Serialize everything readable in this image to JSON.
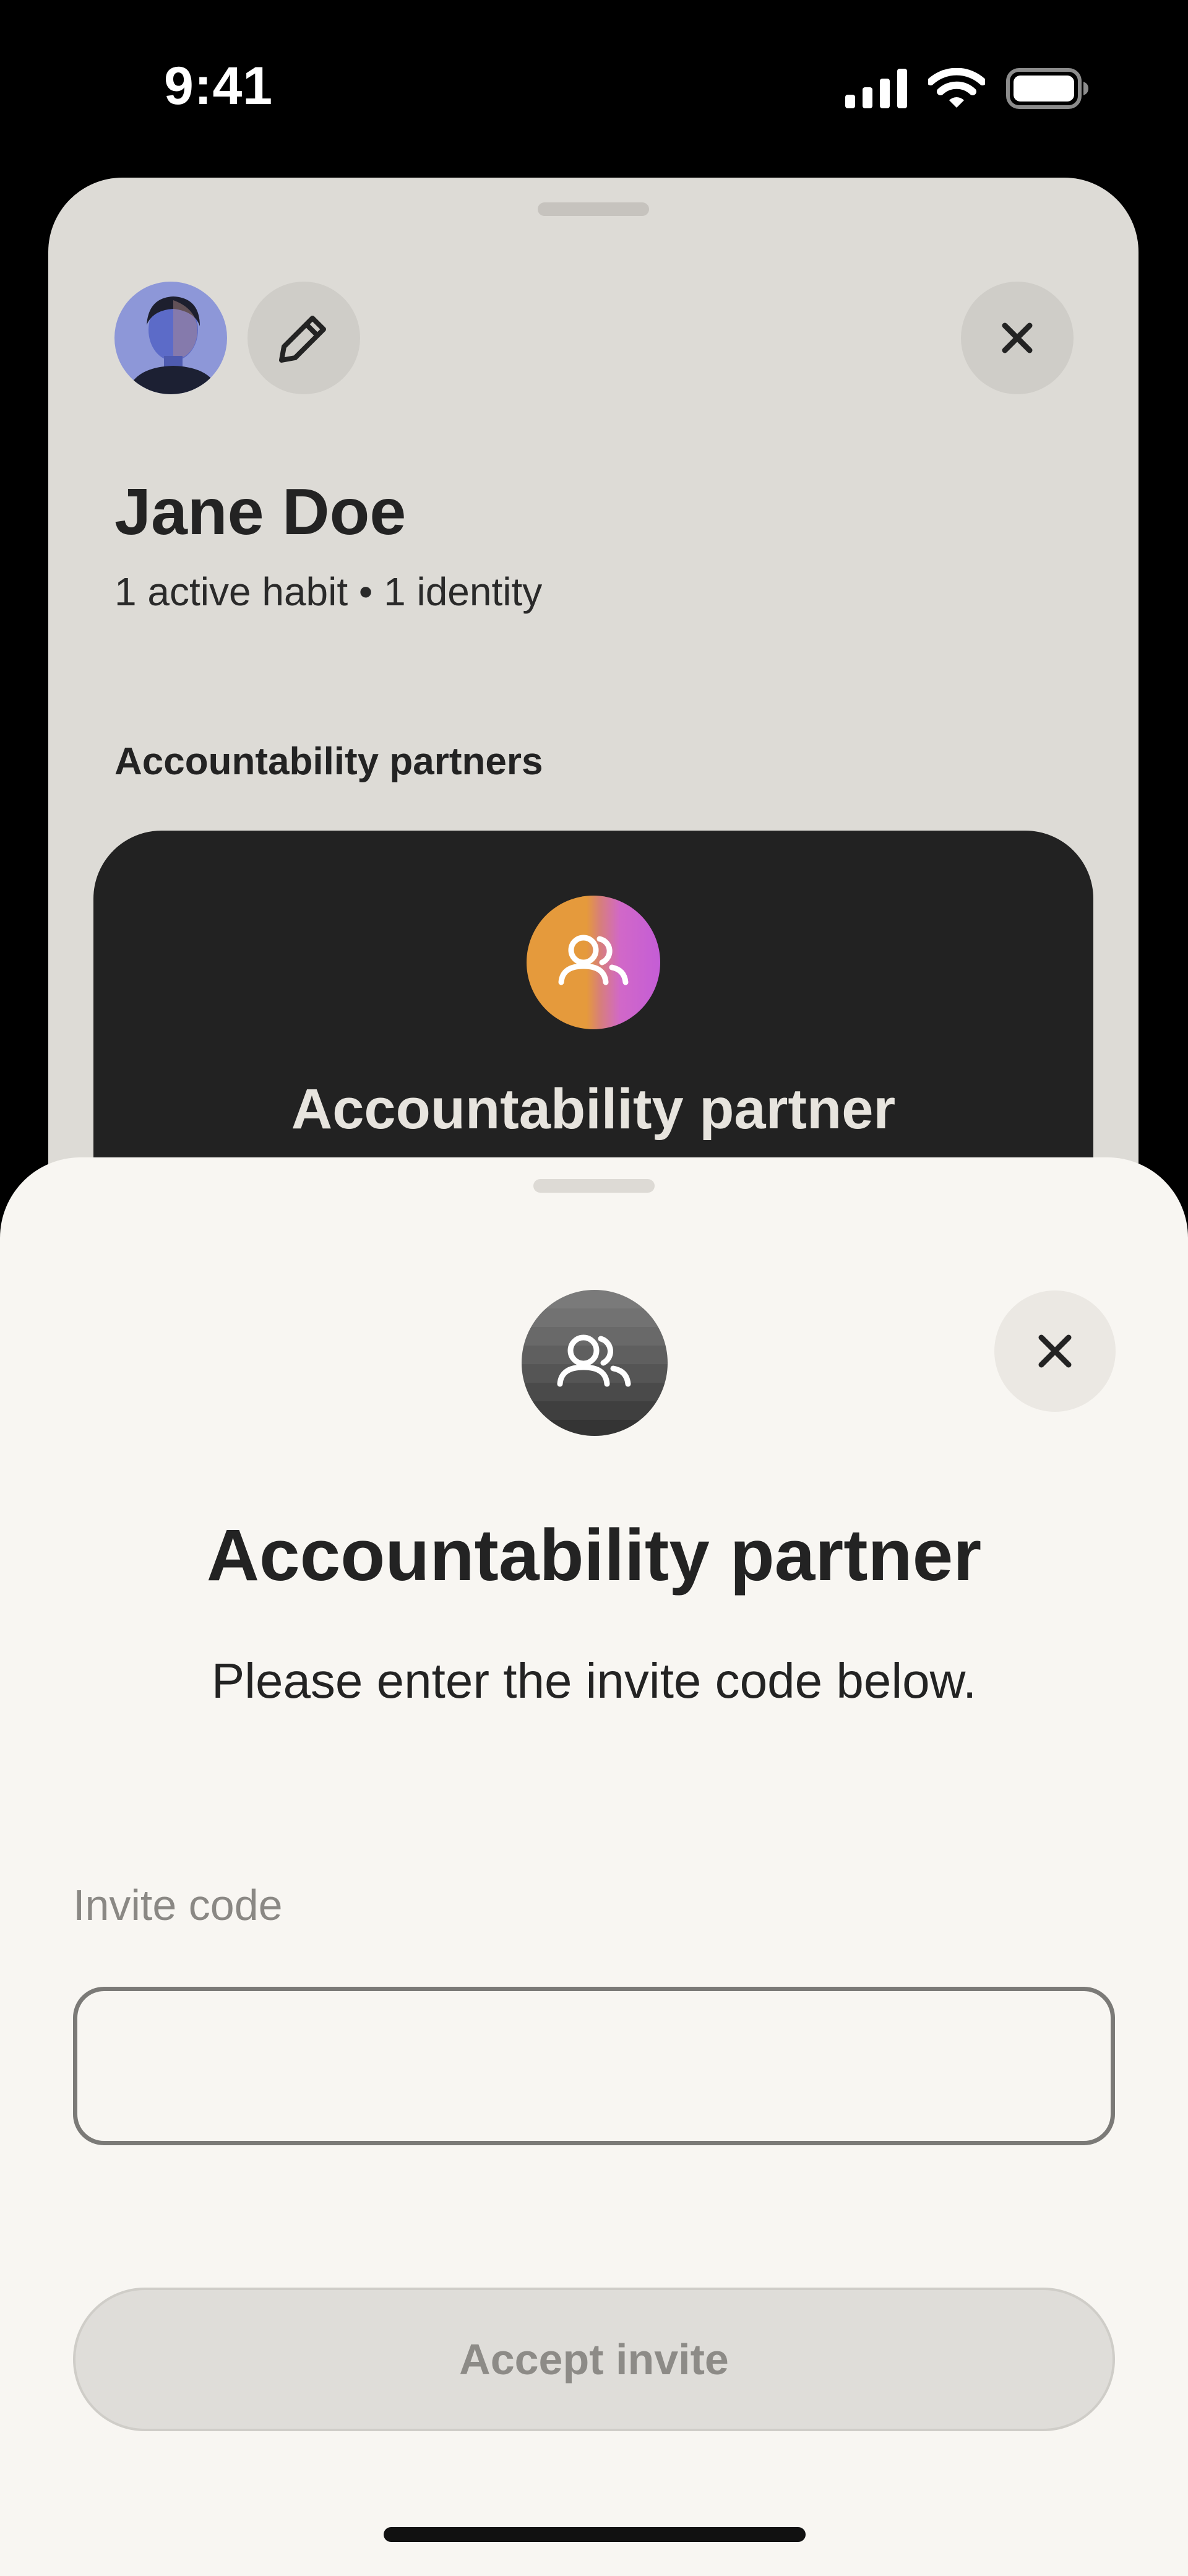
{
  "status_bar": {
    "time": "9:41",
    "icons": [
      "cellular-signal-icon",
      "wifi-icon",
      "battery-icon"
    ]
  },
  "profile": {
    "name": "Jane Doe",
    "stats": "1 active habit • 1 identity",
    "section_title": "Accountability partners",
    "partner_card_title": "Accountability partner",
    "icons": [
      "avatar",
      "pencil-icon",
      "close-icon",
      "people-icon"
    ]
  },
  "modal": {
    "title": "Accountability partner",
    "subtitle": "Please enter the invite code below.",
    "field_label": "Invite code",
    "input_value": "",
    "input_placeholder": "",
    "accept_label": "Accept invite",
    "icons": [
      "people-icon",
      "close-icon"
    ]
  },
  "colors": {
    "page_background": "#000000",
    "profile_sheet": "#dddbd6",
    "modal_sheet": "#f8f6f2",
    "card_dark": "#222222",
    "text_primary": "#232323",
    "text_muted": "#8a8884",
    "partner_gradient": [
      "#e49a3f",
      "#c65ed6"
    ]
  }
}
